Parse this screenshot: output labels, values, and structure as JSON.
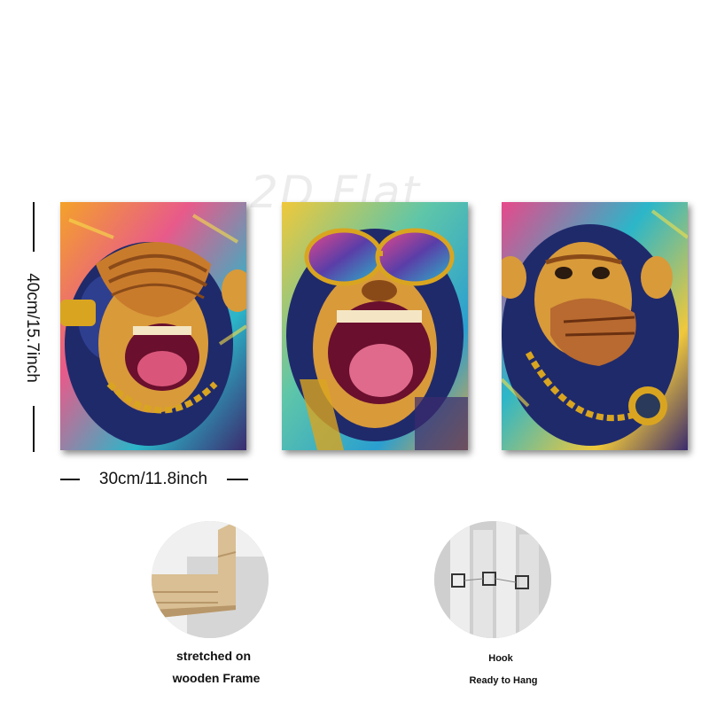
{
  "watermark": "2D Flat",
  "dimensions": {
    "height": "40cm/15.7inch",
    "width": "30cm/11.8inch"
  },
  "panels": [
    {
      "name": "see-no-evil-monkey-painting",
      "gesture": "hand covering eyes"
    },
    {
      "name": "sunglasses-laughing-monkey-painting",
      "gesture": "sunglasses, laughing"
    },
    {
      "name": "speak-no-evil-monkey-painting",
      "gesture": "hand covering mouth"
    }
  ],
  "details": {
    "frame": {
      "caption_line1": "stretched on",
      "caption_line2": "wooden Frame"
    },
    "hook": {
      "caption_line1": "Hook",
      "caption_line2": "Ready to Hang"
    }
  },
  "colors": {
    "fur": "#1f2a6b",
    "face": "#d99a3a",
    "mouth": "#b0185a",
    "gold": "#d9a520",
    "wood": "#d9bf93"
  }
}
